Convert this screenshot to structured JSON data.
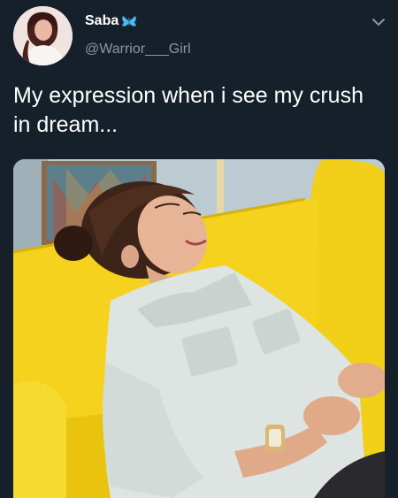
{
  "tweet": {
    "display_name": "Saba",
    "handle": "@Warrior___Girl",
    "text": "My expression when i see my crush in dream...",
    "menu_icon": "chevron-down-icon",
    "badge_icon": "butterfly-icon"
  },
  "colors": {
    "background": "#15202b",
    "text": "#ffffff",
    "muted": "#8899a6",
    "badge": "#4fb6f0",
    "sofa": "#f5d21e"
  }
}
